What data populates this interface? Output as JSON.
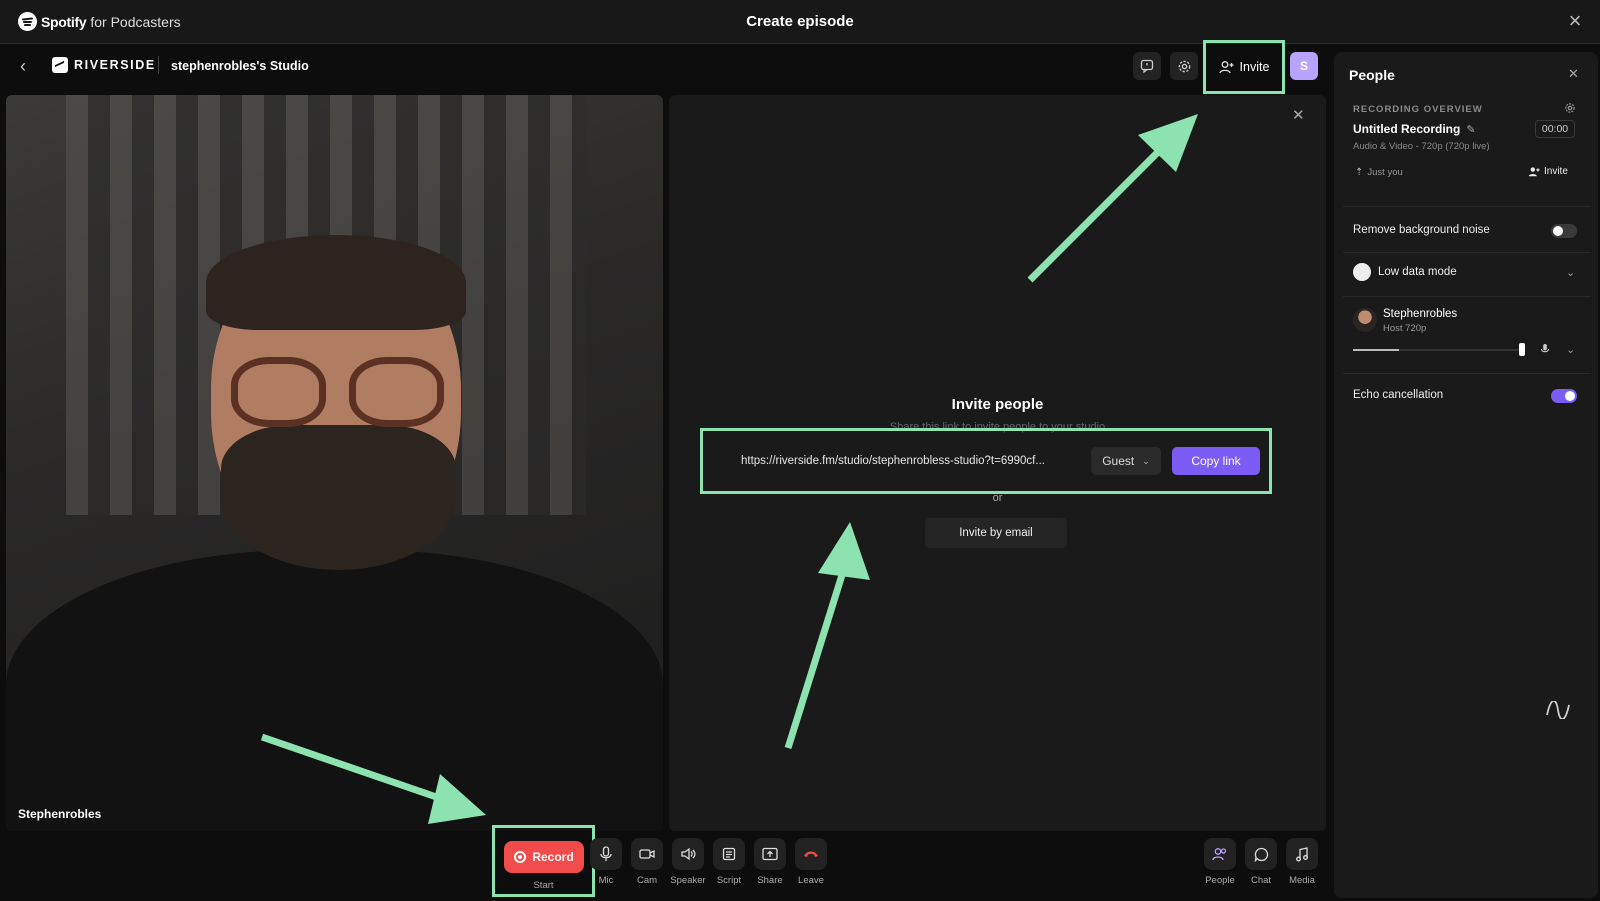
{
  "spotify": {
    "brand": "Spotify",
    "sub": "for Podcasters",
    "title": "Create episode"
  },
  "riverside": {
    "logo": "RIVERSIDE",
    "studio": "stephenrobles's Studio",
    "invite_label": "Invite",
    "avatar_initial": "S"
  },
  "video": {
    "participant": "Stephenrobles"
  },
  "invite_panel": {
    "title": "Invite people",
    "subtitle": "Share this link to invite people to your studio",
    "link": "https://riverside.fm/studio/stephenrobless-studio?t=6990cf...",
    "role": "Guest",
    "copy_label": "Copy link",
    "or": "or",
    "email_label": "Invite by email"
  },
  "controls": {
    "record_label": "Record",
    "record_sub": "Start",
    "items": [
      {
        "label": "Mic",
        "icon": "mic-icon"
      },
      {
        "label": "Cam",
        "icon": "camera-icon"
      },
      {
        "label": "Speaker",
        "icon": "speaker-icon"
      },
      {
        "label": "Script",
        "icon": "script-icon"
      },
      {
        "label": "Share",
        "icon": "share-icon"
      },
      {
        "label": "Leave",
        "icon": "leave-icon"
      },
      {
        "label": "People",
        "icon": "people-icon"
      },
      {
        "label": "Chat",
        "icon": "chat-icon"
      },
      {
        "label": "Media",
        "icon": "media-icon"
      }
    ]
  },
  "people_panel": {
    "title": "People",
    "overview_label": "RECORDING OVERVIEW",
    "recording_title": "Untitled Recording",
    "timer": "00:00",
    "format": "Audio & Video - 720p (720p live)",
    "just_you": "Just you",
    "invite": "Invite",
    "noise_label": "Remove background noise",
    "noise_on": false,
    "low_data_label": "Low data mode",
    "host_name": "Stephenrobles",
    "host_meta": "Host  720p",
    "echo_label": "Echo cancellation",
    "echo_on": true
  },
  "colors": {
    "accent": "#7b5cf5",
    "record": "#f24b4b",
    "highlight": "#8de3b0"
  }
}
